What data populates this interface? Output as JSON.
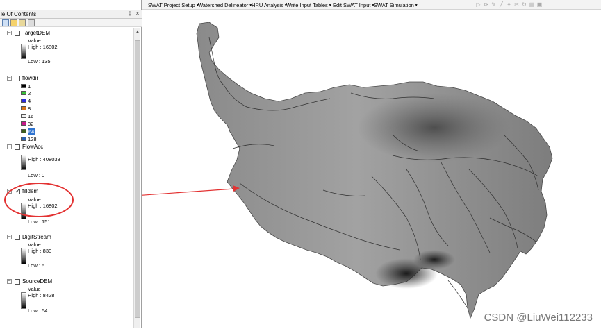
{
  "toc": {
    "title": "le Of Contents",
    "pin": "‡",
    "close": "×"
  },
  "menus": [
    {
      "label": "SWAT Project Setup"
    },
    {
      "label": "Watershed Delineator"
    },
    {
      "label": "HRU Analysis"
    },
    {
      "label": "Write Input Tables"
    },
    {
      "label": "Edit SWAT Input"
    },
    {
      "label": "SWAT Simulation"
    }
  ],
  "layers": {
    "targetdem": {
      "name": "TargetDEM",
      "checked": false,
      "value_label": "Value",
      "high": "High : 16802",
      "low": "Low : 135"
    },
    "flowdir": {
      "name": "flowdir",
      "checked": false,
      "classes": [
        {
          "label": "1",
          "color": "#000000"
        },
        {
          "label": "2",
          "color": "#38c238"
        },
        {
          "label": "4",
          "color": "#2b2bd9"
        },
        {
          "label": "8",
          "color": "#d6741a"
        },
        {
          "label": "16",
          "color": "#f2f2f2"
        },
        {
          "label": "32",
          "color": "#c7188b"
        },
        {
          "label": "64",
          "color": "#3c5c1e"
        },
        {
          "label": "128",
          "color": "#2b62b0"
        }
      ]
    },
    "flowacc": {
      "name": "FlowAcc",
      "checked": false,
      "high": "High : 408038",
      "low": "Low : 0"
    },
    "filldem": {
      "name": "filldem",
      "checked": true,
      "value_label": "Value",
      "high": "High : 16802",
      "low": "Low : 151"
    },
    "digitstream": {
      "name": "DigitStream",
      "checked": false,
      "value_label": "Value",
      "high": "High : 830",
      "low": "Low : 5"
    },
    "sourcedem": {
      "name": "SourceDEM",
      "checked": false,
      "value_label": "Value",
      "high": "High : 8428",
      "low": "Low : 54"
    }
  },
  "colors": {
    "annotation": "#e33232",
    "selection": "#2f74d0"
  },
  "watermark": "CSDN @LiuWei112233"
}
